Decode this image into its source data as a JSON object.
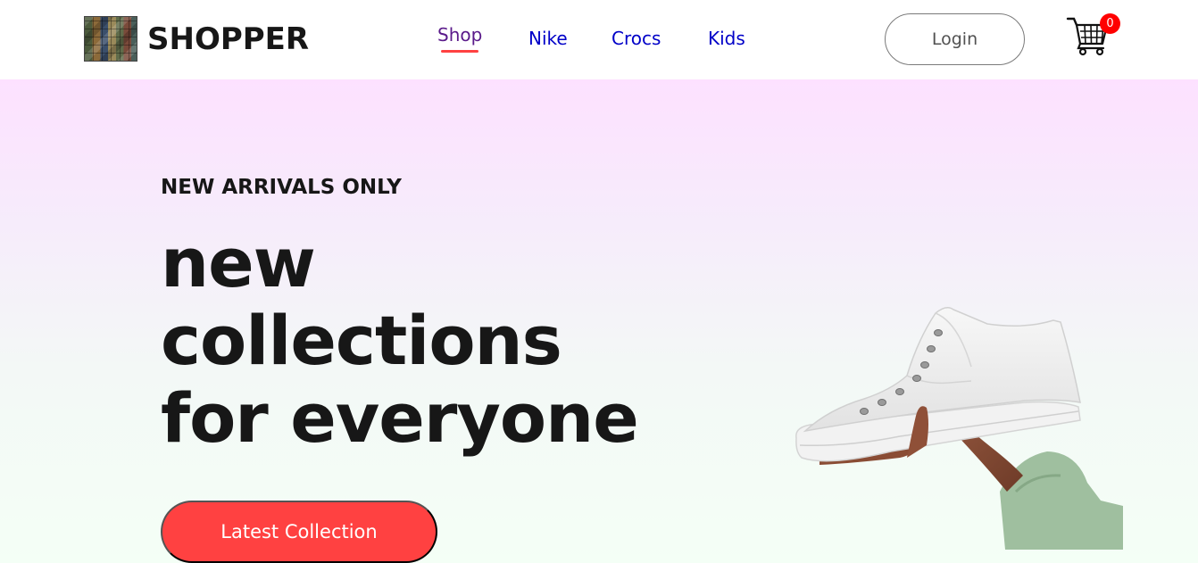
{
  "header": {
    "brand": "SHOPPER",
    "logo_icon": "shop-logo-image",
    "nav": [
      {
        "label": "Shop",
        "active": true
      },
      {
        "label": "Nike"
      },
      {
        "label": "Crocs"
      },
      {
        "label": "Kids"
      }
    ],
    "login_label": "Login",
    "cart_icon": "shopping-cart-icon",
    "cart_count": "0"
  },
  "hero": {
    "kicker": "NEW ARRIVALS ONLY",
    "headline": [
      "new",
      "collections",
      "for everyone"
    ],
    "cta_label": "Latest Collection",
    "image": "hand-holding-white-sneaker"
  },
  "colors": {
    "accent": "#ff4141",
    "nav_link": "#0000c8",
    "nav_active": "#5a1a8a",
    "hero_top": "#fde1ff",
    "hero_bottom": "#f4fff6",
    "text": "#171717"
  }
}
